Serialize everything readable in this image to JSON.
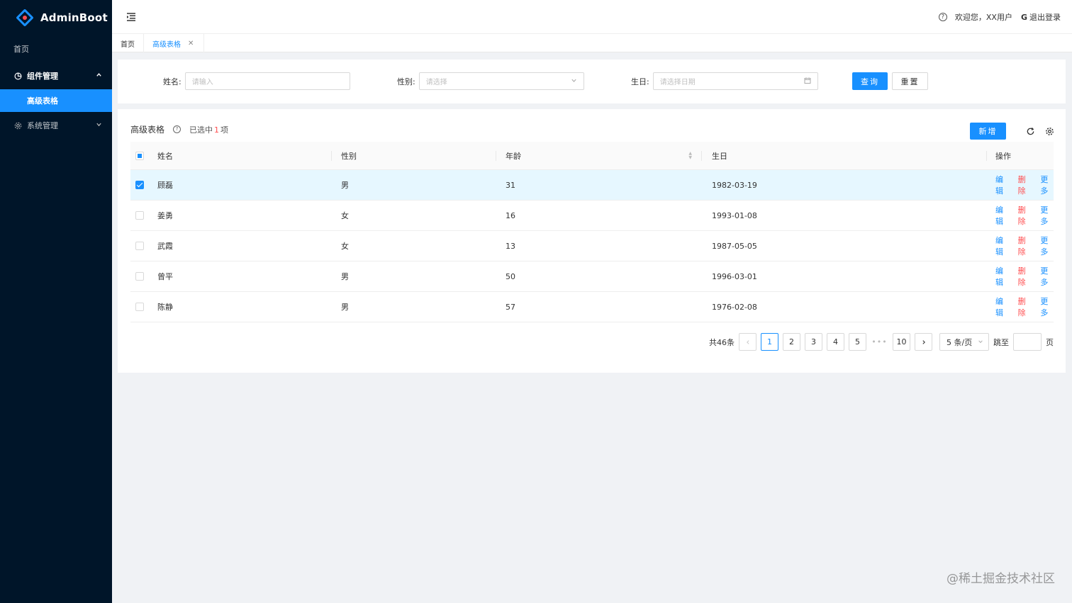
{
  "app": {
    "name": "AdminBoot"
  },
  "sidebar": {
    "items": [
      {
        "label": "首页"
      },
      {
        "label": "组件管理",
        "children": [
          {
            "label": "高级表格"
          }
        ]
      },
      {
        "label": "系统管理"
      }
    ]
  },
  "header": {
    "welcome": "欢迎您，XX用户",
    "logout": "退出登录"
  },
  "tabs": [
    {
      "label": "首页"
    },
    {
      "label": "高级表格"
    }
  ],
  "search": {
    "name_label": "姓名:",
    "name_placeholder": "请输入",
    "sex_label": "性别:",
    "sex_placeholder": "请选择",
    "birthday_label": "生日:",
    "birthday_placeholder": "请选择日期",
    "query_label": "查询",
    "reset_label": "重置"
  },
  "table": {
    "title": "高级表格",
    "selected_prefix": "已选中",
    "selected_count": "1",
    "selected_suffix": "项",
    "add_label": "新增",
    "columns": {
      "name": "姓名",
      "sex": "性别",
      "age": "年龄",
      "birthday": "生日",
      "action": "操作"
    },
    "rows": [
      {
        "name": "顾磊",
        "sex": "男",
        "age": "31",
        "birthday": "1982-03-19",
        "selected": true
      },
      {
        "name": "姜勇",
        "sex": "女",
        "age": "16",
        "birthday": "1993-01-08",
        "selected": false
      },
      {
        "name": "武霞",
        "sex": "女",
        "age": "13",
        "birthday": "1987-05-05",
        "selected": false
      },
      {
        "name": "曾平",
        "sex": "男",
        "age": "50",
        "birthday": "1996-03-01",
        "selected": false
      },
      {
        "name": "陈静",
        "sex": "男",
        "age": "57",
        "birthday": "1976-02-08",
        "selected": false
      }
    ],
    "actions": {
      "edit": "编辑",
      "delete": "删除",
      "more": "更多"
    }
  },
  "pagination": {
    "total": "共46条",
    "pages": [
      "1",
      "2",
      "3",
      "4",
      "5"
    ],
    "ellipsis": "•••",
    "last": "10",
    "current": "1",
    "page_size": "5 条/页",
    "jump_label": "跳至",
    "page_suffix": "页"
  },
  "watermark": "@稀土掘金技术社区",
  "colors": {
    "primary": "#1890ff",
    "danger": "#ff4d4f",
    "sidebar": "#001529"
  }
}
